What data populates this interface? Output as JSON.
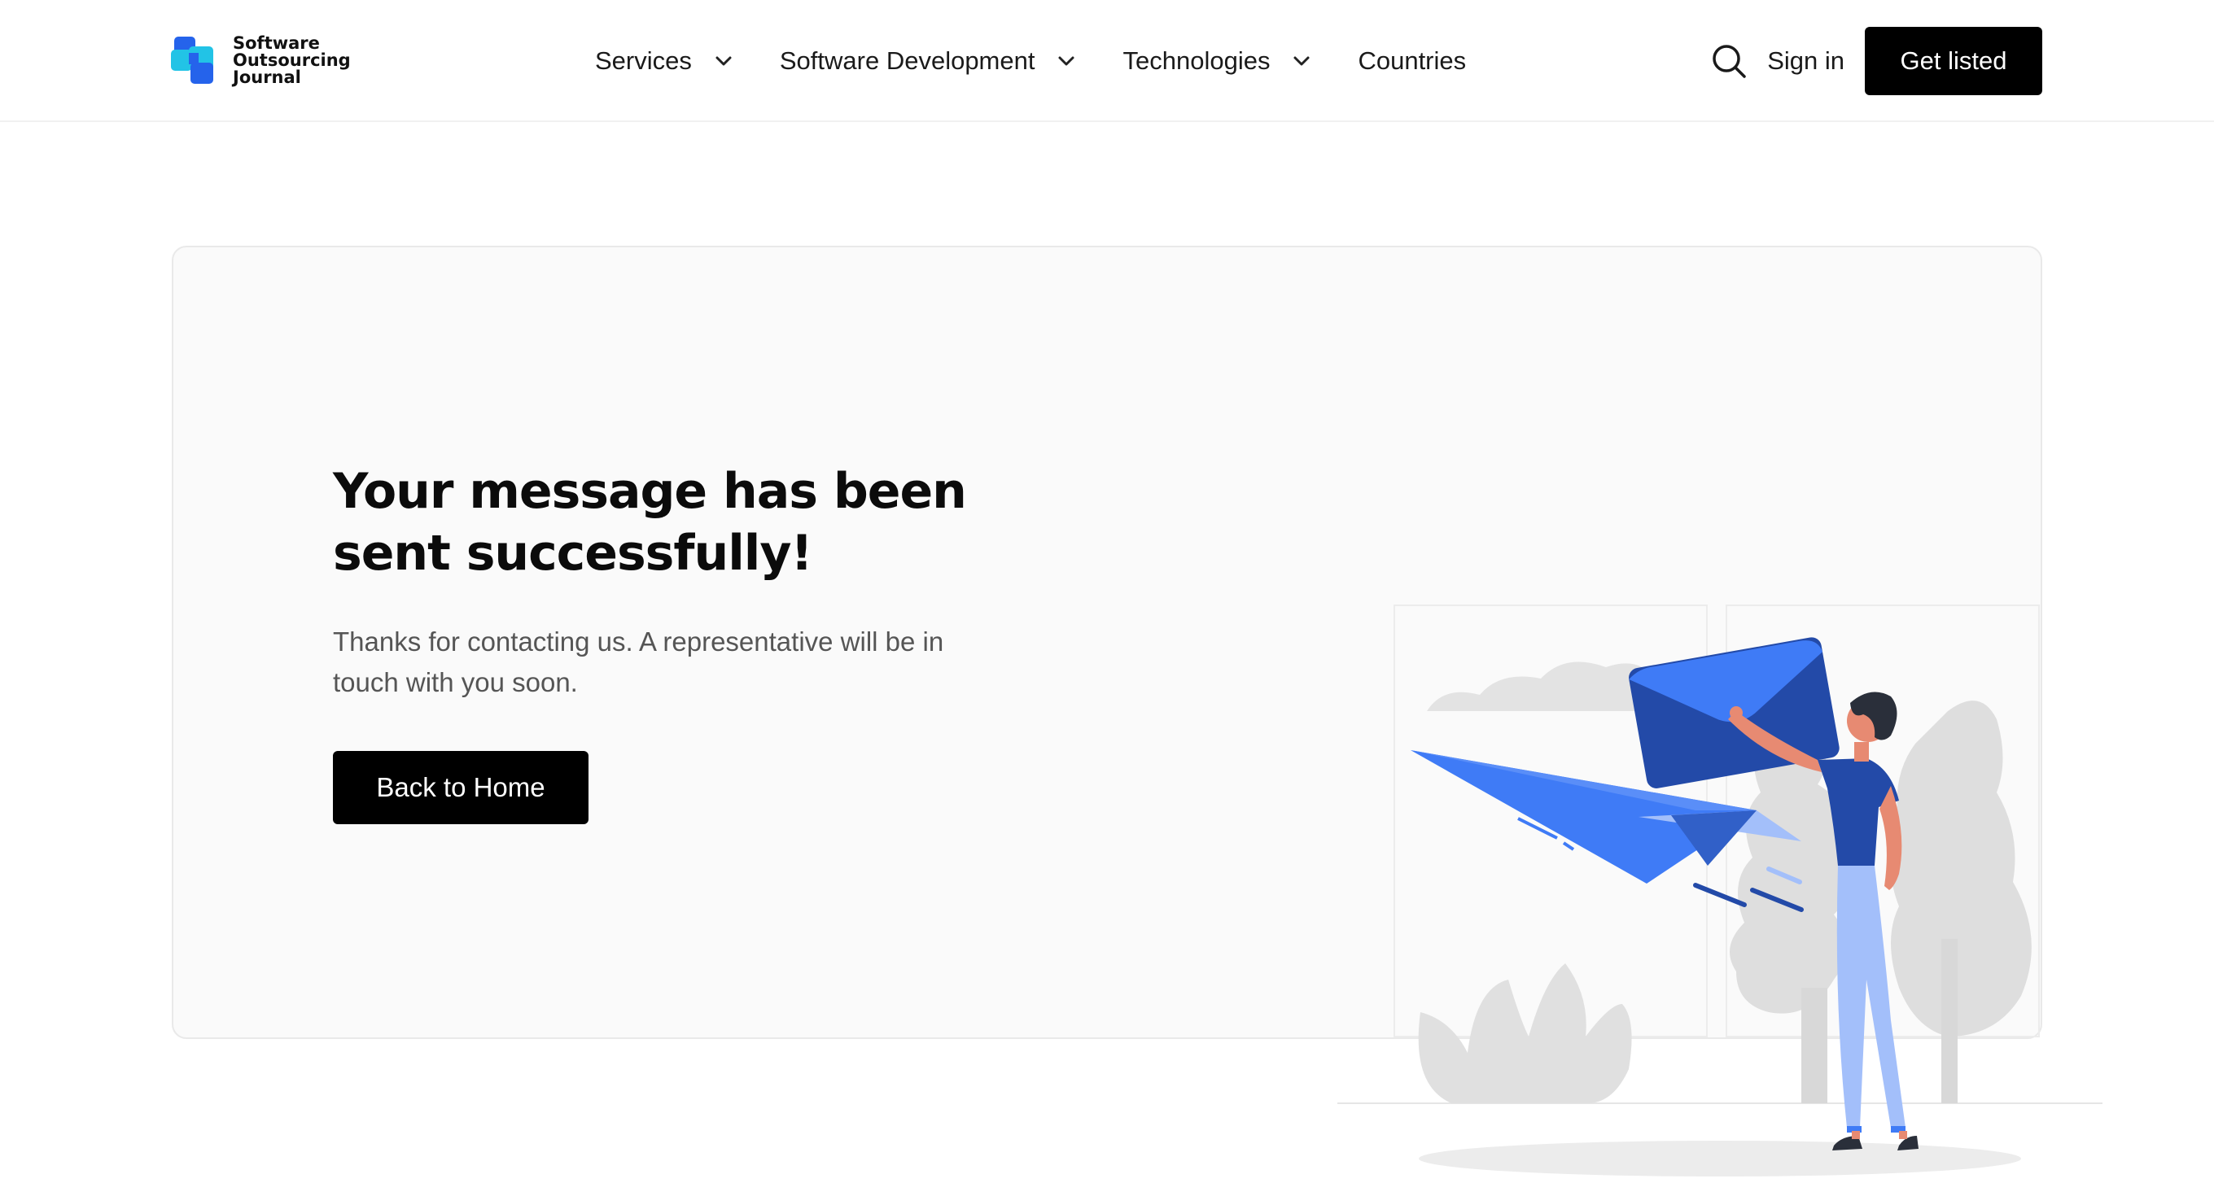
{
  "header": {
    "logo": {
      "lines": [
        "Software",
        "Outsourcing",
        "Journal"
      ],
      "colors": {
        "primary": "#2563eb",
        "secondary": "#22c3e6"
      }
    },
    "nav": [
      {
        "label": "Services",
        "has_dropdown": true
      },
      {
        "label": "Software Development",
        "has_dropdown": true
      },
      {
        "label": "Technologies",
        "has_dropdown": true
      },
      {
        "label": "Countries",
        "has_dropdown": false
      }
    ],
    "search_icon": "search-icon",
    "sign_in": "Sign in",
    "cta": "Get listed"
  },
  "main": {
    "title": "Your message has been sent successfully!",
    "message": "Thanks for contacting us. A representative will be in touch with you soon.",
    "back_button": "Back to Home",
    "illustration": "man-sending-paper-plane-envelope-illustration"
  },
  "colors": {
    "accent_blue": "#3f7bf6",
    "dark_blue": "#234aa8",
    "light_blue": "#a3bffa",
    "button_bg": "#000000",
    "card_bg": "#fafafa"
  }
}
